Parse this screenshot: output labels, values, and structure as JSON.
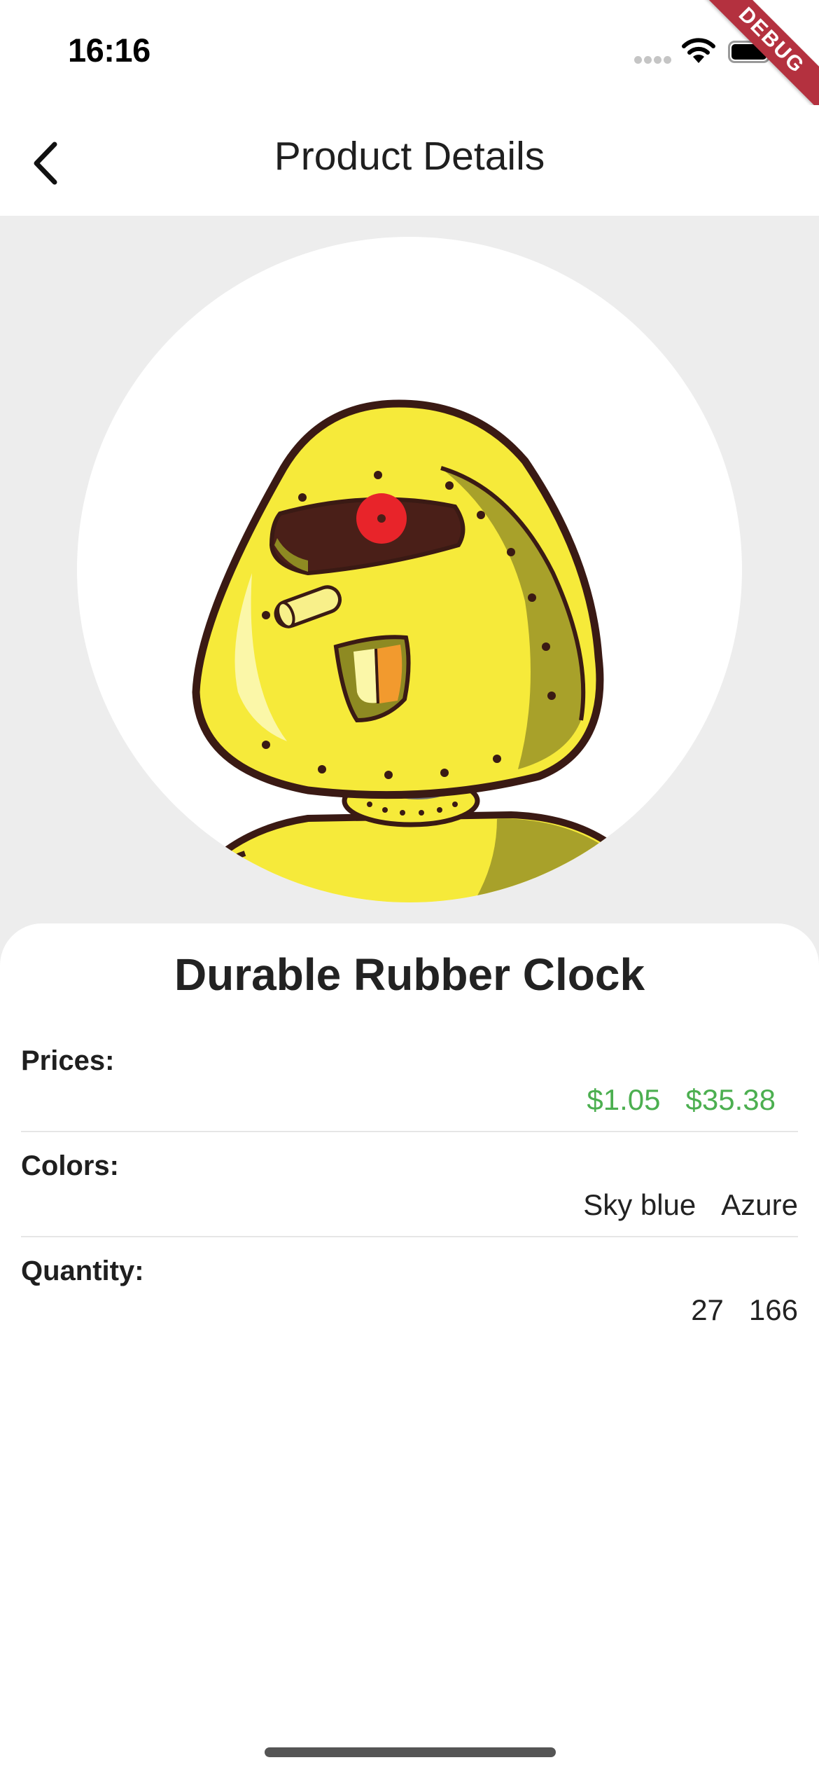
{
  "status_bar": {
    "time": "16:16",
    "debug_label": "DEBUG"
  },
  "app_bar": {
    "title": "Product Details",
    "back_icon": "chevron-left-icon"
  },
  "product": {
    "name": "Durable Rubber Clock",
    "image_icon": "robot-avatar-image"
  },
  "details": {
    "prices": {
      "label": "Prices:",
      "values": [
        "$1.05",
        "$35.38"
      ]
    },
    "colors": {
      "label": "Colors:",
      "values": [
        "Sky blue",
        "Azure"
      ]
    },
    "quantity": {
      "label": "Quantity:",
      "values": [
        "27",
        "166"
      ]
    }
  },
  "theme": {
    "price_color": "#4caf50",
    "background_gray": "#ededed",
    "debug_banner_color": "#b4313f"
  }
}
